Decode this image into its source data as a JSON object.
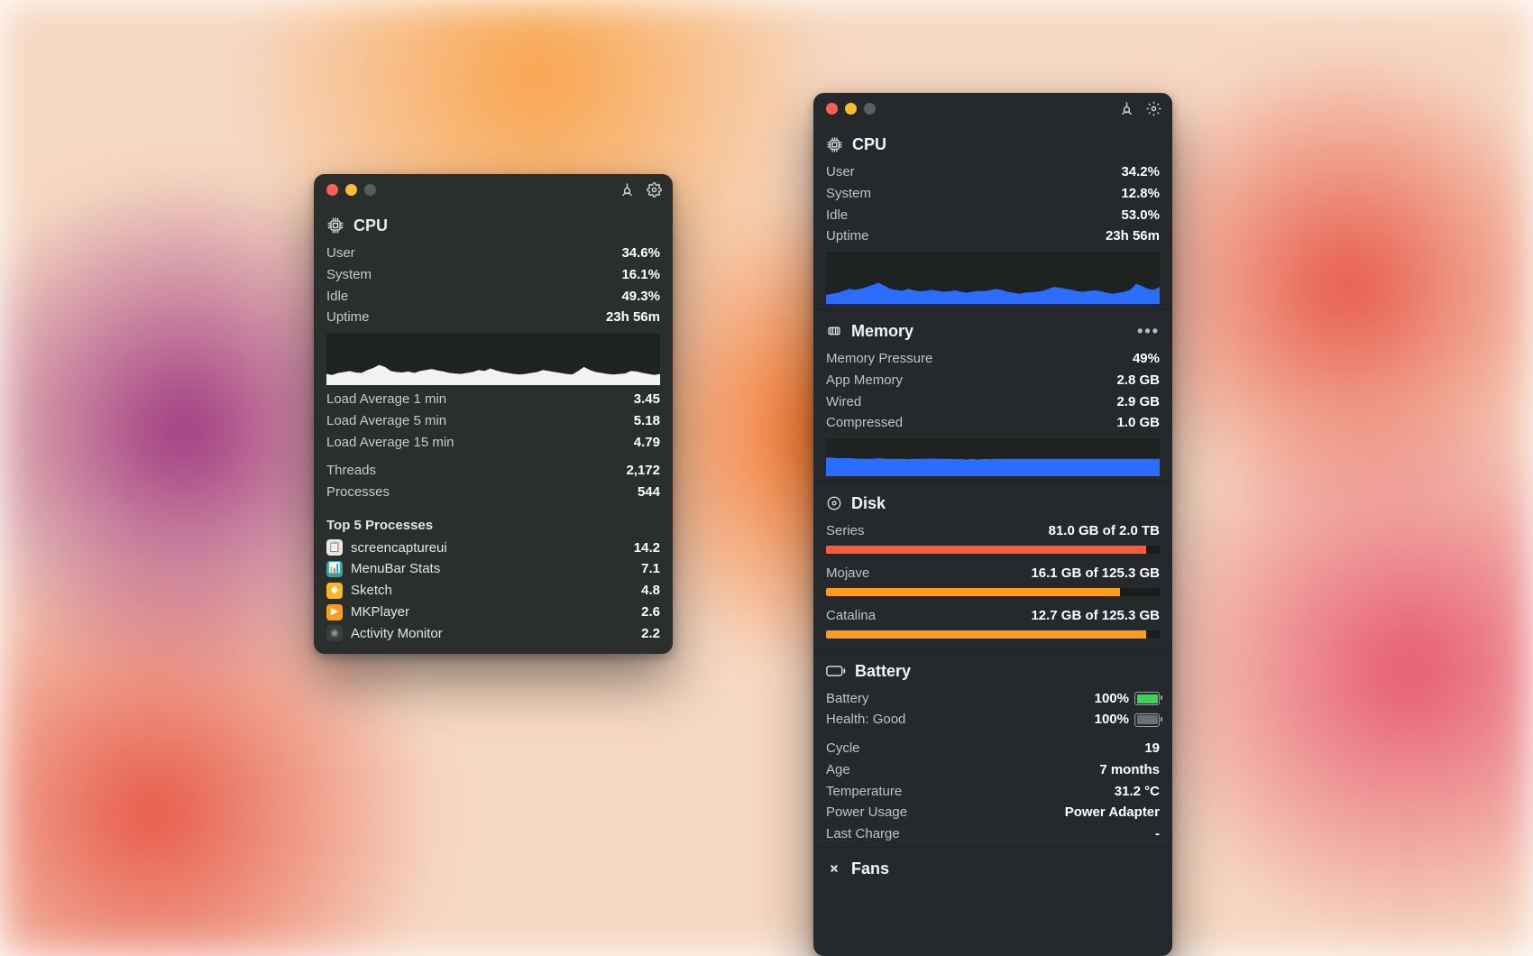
{
  "window1": {
    "cpu": {
      "title": "CPU",
      "stats": {
        "user_label": "User",
        "user_val": "34.6%",
        "system_label": "System",
        "system_val": "16.1%",
        "idle_label": "Idle",
        "idle_val": "49.3%",
        "uptime_label": "Uptime",
        "uptime_val": "23h 56m"
      },
      "load": {
        "l1_label": "Load Average 1 min",
        "l1_val": "3.45",
        "l5_label": "Load Average 5 min",
        "l5_val": "5.18",
        "l15_label": "Load Average 15 min",
        "l15_val": "4.79"
      },
      "counts": {
        "threads_label": "Threads",
        "threads_val": "2,172",
        "procs_label": "Processes",
        "procs_val": "544"
      },
      "top": {
        "heading": "Top 5 Processes",
        "p1_name": "screencaptureui",
        "p1_val": "14.2",
        "p2_name": "MenuBar Stats",
        "p2_val": "7.1",
        "p3_name": "Sketch",
        "p3_val": "4.8",
        "p4_name": "MKPlayer",
        "p4_val": "2.6",
        "p5_name": "Activity Monitor",
        "p5_val": "2.2"
      }
    }
  },
  "window2": {
    "cpu": {
      "title": "CPU",
      "stats": {
        "user_label": "User",
        "user_val": "34.2%",
        "system_label": "System",
        "system_val": "12.8%",
        "idle_label": "Idle",
        "idle_val": "53.0%",
        "uptime_label": "Uptime",
        "uptime_val": "23h 56m"
      }
    },
    "memory": {
      "title": "Memory",
      "stats": {
        "pressure_label": "Memory Pressure",
        "pressure_val": "49%",
        "app_label": "App Memory",
        "app_val": "2.8 GB",
        "wired_label": "Wired",
        "wired_val": "2.9 GB",
        "compressed_label": "Compressed",
        "compressed_val": "1.0 GB"
      }
    },
    "disk": {
      "title": "Disk",
      "d1_name": "Series",
      "d1_val": "81.0 GB of 2.0 TB",
      "d1_pct": 96,
      "d2_name": "Mojave",
      "d2_val": "16.1 GB of 125.3 GB",
      "d2_pct": 88,
      "d3_name": "Catalina",
      "d3_val": "12.7 GB of 125.3 GB",
      "d3_pct": 96
    },
    "battery": {
      "title": "Battery",
      "batt_label": "Battery",
      "batt_val": "100%",
      "health_label": "Health: Good",
      "health_val": "100%",
      "cycle_label": "Cycle",
      "cycle_val": "19",
      "age_label": "Age",
      "age_val": "7 months",
      "temp_label": "Temperature",
      "temp_val": "31.2 °C",
      "power_label": "Power Usage",
      "power_val": "Power Adapter",
      "last_label": "Last Charge",
      "last_val": "-"
    },
    "fans": {
      "title": "Fans"
    }
  },
  "chart_data": [
    {
      "type": "area",
      "title": "CPU usage (window 1)",
      "series_name": "CPU %",
      "values": [
        22,
        20,
        24,
        26,
        28,
        25,
        24,
        30,
        34,
        40,
        36,
        28,
        26,
        25,
        27,
        24,
        28,
        30,
        32,
        29,
        27,
        24,
        23,
        22,
        24,
        26,
        30,
        28,
        33,
        29,
        26,
        24,
        22,
        21,
        22,
        24,
        26,
        30,
        28,
        26,
        24,
        22,
        21,
        28,
        36,
        30,
        26,
        24,
        22,
        21,
        22,
        23,
        28,
        27,
        24,
        22,
        20,
        22
      ],
      "ylim": [
        0,
        100
      ],
      "ylabel": "%",
      "xlabel": ""
    },
    {
      "type": "area",
      "title": "CPU usage (window 2)",
      "series_name": "CPU %",
      "values": [
        18,
        20,
        22,
        26,
        30,
        28,
        30,
        34,
        38,
        42,
        36,
        30,
        28,
        26,
        30,
        27,
        25,
        26,
        28,
        26,
        24,
        25,
        27,
        24,
        22,
        24,
        26,
        25,
        27,
        30,
        28,
        24,
        22,
        20,
        22,
        23,
        24,
        26,
        30,
        34,
        32,
        30,
        28,
        25,
        24,
        26,
        27,
        25,
        22,
        20,
        22,
        24,
        28,
        40,
        35,
        30,
        28,
        34
      ],
      "ylim": [
        0,
        100
      ],
      "ylabel": "%",
      "xlabel": ""
    },
    {
      "type": "area",
      "title": "Memory pressure (window 2)",
      "series_name": "Pressure %",
      "values": [
        52,
        52,
        50,
        50,
        50,
        49,
        48,
        48,
        48,
        50,
        48,
        48,
        48,
        48,
        47,
        48,
        48,
        48,
        49,
        48,
        48,
        48,
        47,
        48,
        46,
        48,
        46,
        48,
        47,
        48,
        48,
        48,
        48,
        48,
        48,
        48,
        48,
        48,
        48,
        48,
        48,
        48,
        48,
        48,
        48,
        48,
        48,
        48,
        48,
        48,
        48,
        48,
        48,
        48,
        48,
        48,
        48,
        48
      ],
      "ylim": [
        0,
        100
      ],
      "ylabel": "%",
      "xlabel": ""
    }
  ]
}
